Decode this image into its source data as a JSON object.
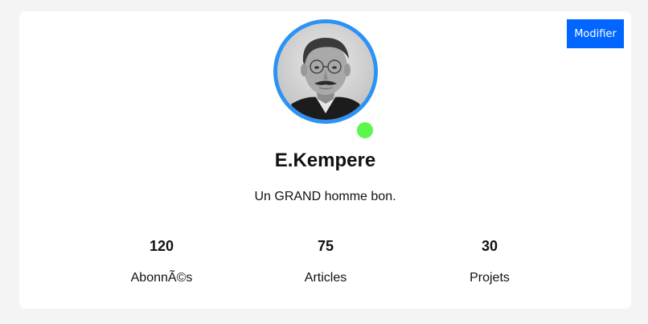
{
  "profile": {
    "edit_label": "Modifier",
    "name": "E.Kempere",
    "bio": "Un GRAND homme bon.",
    "status": "online",
    "avatar_icon": "profile-photo",
    "accent_color": "#2d93f2",
    "online_color": "#5cf64c",
    "button_color": "#0066ff"
  },
  "stats": [
    {
      "value": "120",
      "label": "AbonnÃ©s"
    },
    {
      "value": "75",
      "label": "Articles"
    },
    {
      "value": "30",
      "label": "Projets"
    }
  ]
}
